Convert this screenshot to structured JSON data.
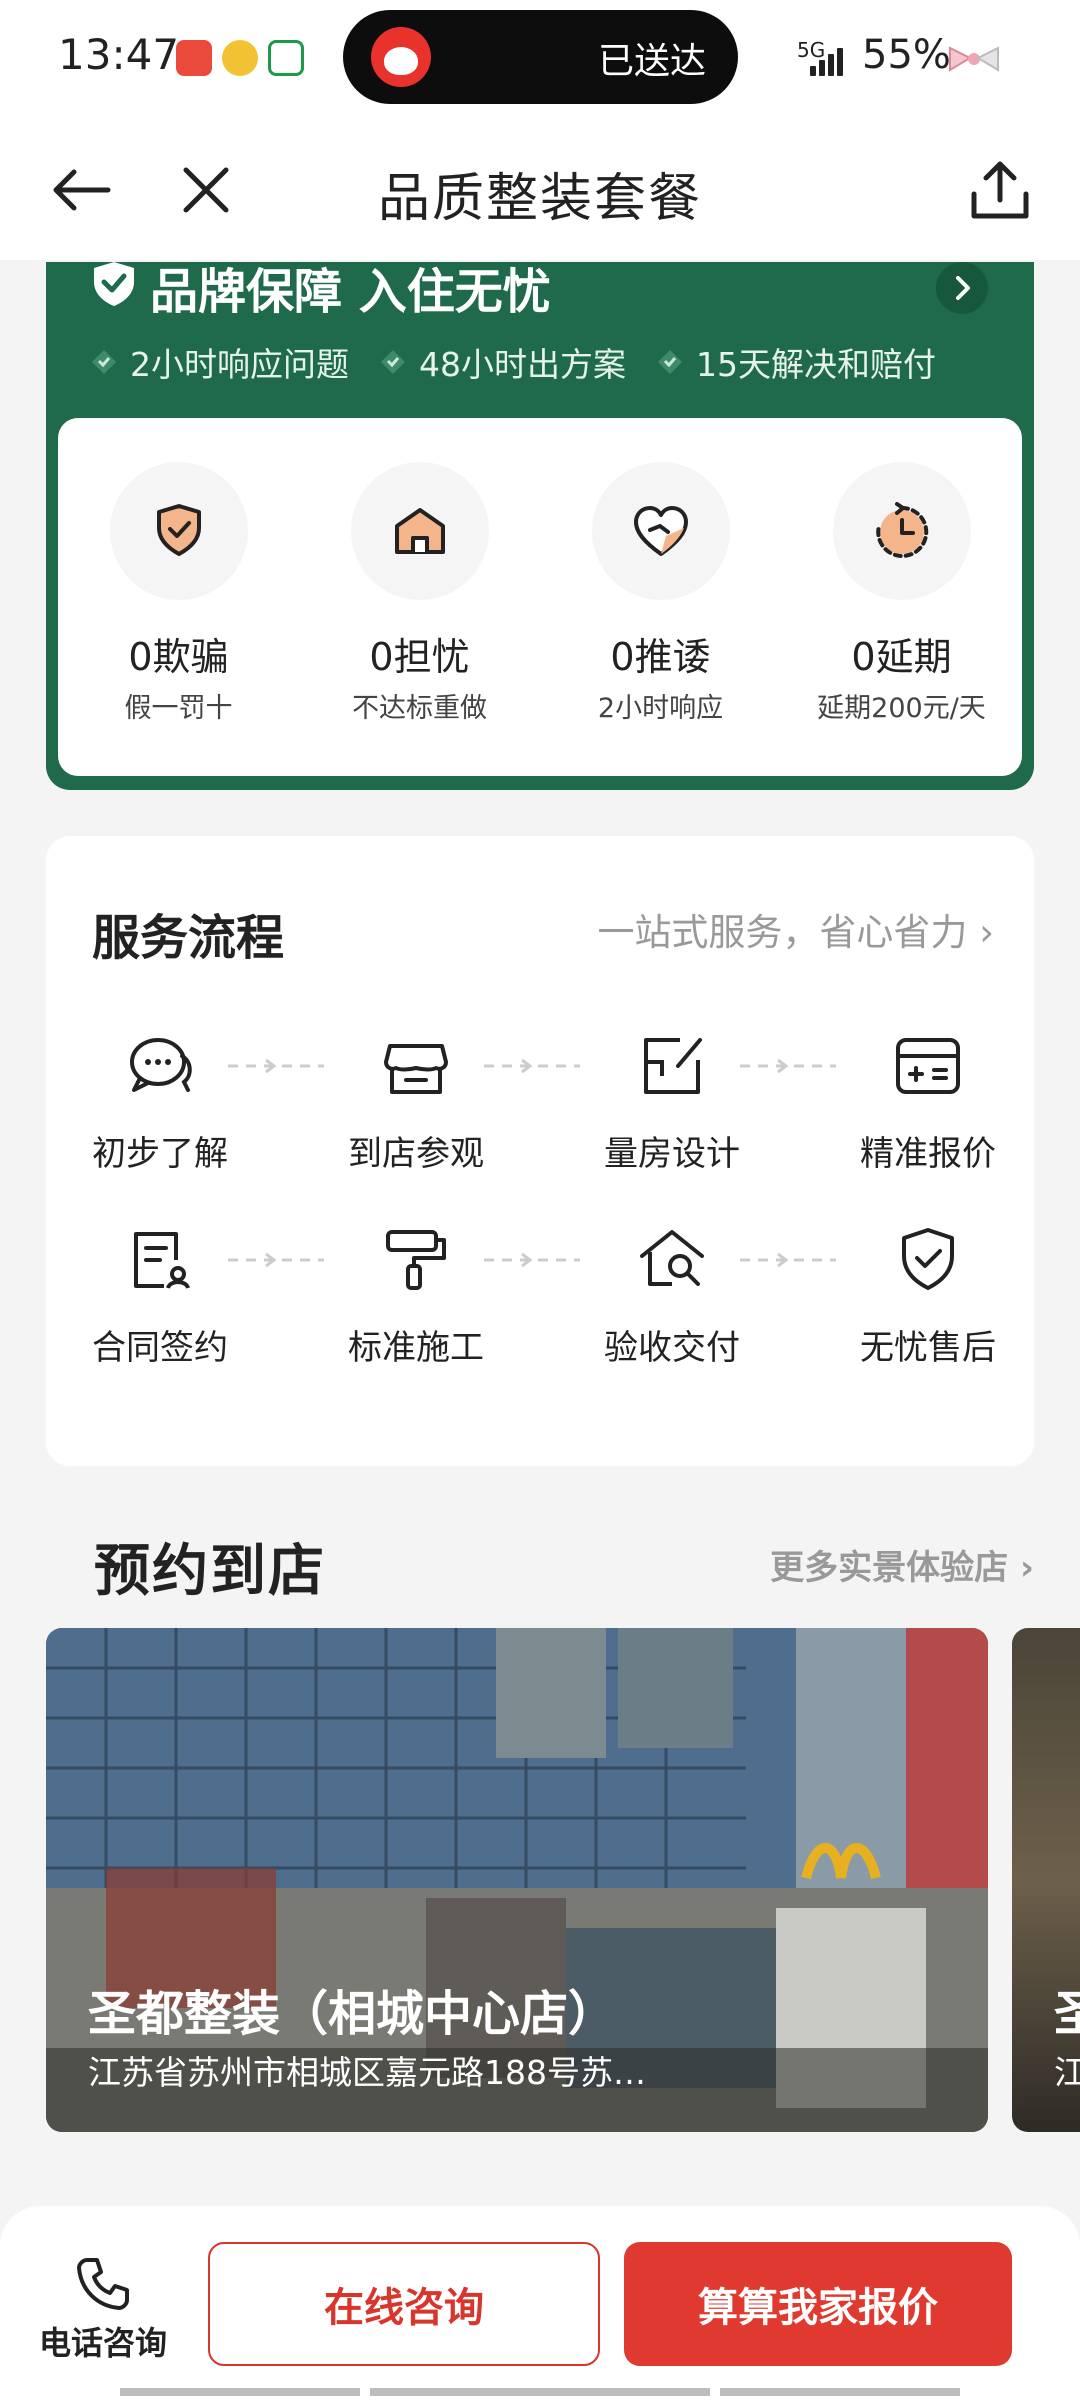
{
  "status_bar": {
    "time": "13:47",
    "island_text": "已送达",
    "network": "5G",
    "battery": "55%"
  },
  "nav": {
    "title": "品质整装套餐"
  },
  "guarantee": {
    "title": "品牌保障 入住无忧",
    "features": [
      "2小时响应问题",
      "48小时出方案",
      "15天解决和赔付"
    ],
    "items": [
      {
        "label": "0欺骗",
        "sub": "假一罚十",
        "icon": "shield-check-icon"
      },
      {
        "label": "0担忧",
        "sub": "不达标重做",
        "icon": "house-icon"
      },
      {
        "label": "0推诿",
        "sub": "2小时响应",
        "icon": "heart-icon"
      },
      {
        "label": "0延期",
        "sub": "延期200元/天",
        "icon": "clock-icon"
      }
    ]
  },
  "process": {
    "title": "服务流程",
    "more": "一站式服务，省心省力",
    "steps": [
      "初步了解",
      "到店参观",
      "量房设计",
      "精准报价",
      "合同签约",
      "标准施工",
      "验收交付",
      "无忧售后"
    ]
  },
  "booking": {
    "title": "预约到店",
    "more": "更多实景体验店",
    "stores": [
      {
        "name": "圣都整装（相城中心店）",
        "address": "江苏省苏州市相城区嘉元路188号苏…"
      },
      {
        "name": "圣",
        "address": "江"
      }
    ]
  },
  "bottom": {
    "phone_label": "电话咨询",
    "online_label": "在线咨询",
    "quote_label": "算算我家报价"
  },
  "colors": {
    "brand_green": "#1e6a4b",
    "accent_red": "#e0392f",
    "icon_orange": "#f5b58a"
  }
}
